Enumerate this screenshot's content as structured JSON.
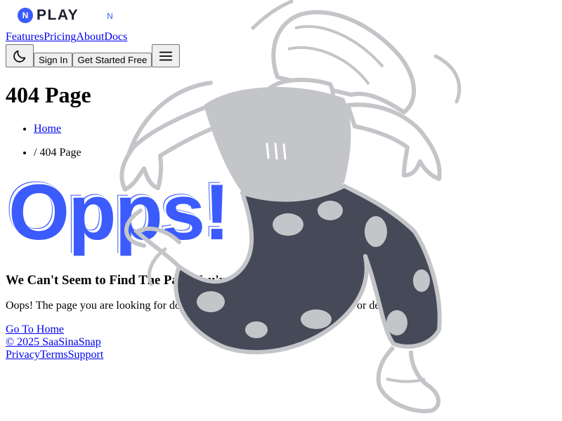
{
  "brand": {
    "name": "PLAY",
    "mark": "N",
    "accent_color": "#3b5bfd"
  },
  "nav": {
    "links": [
      "Features",
      "Pricing",
      "About",
      "Docs"
    ],
    "theme_icon": "moon-icon",
    "sign_in": "Sign In",
    "get_started": "Get Started Free",
    "menu_icon": "hamburger-menu-icon"
  },
  "page": {
    "title": "404 Page",
    "breadcrumbs": {
      "home": "Home",
      "current": "/ 404 Page"
    },
    "big_text": "Opps!",
    "headline": "We Can't Seem to Find The Page You're Looking For",
    "message": "Oops! The page you are looking for does not exist. It might have been moved or deleted.",
    "home_link": "Go To Home"
  },
  "footer": {
    "copyright": "© 2025 SaaSinaSnap",
    "links": [
      "Privacy",
      "Terms",
      "Support"
    ]
  },
  "illustration": {
    "icon": "dancing-character-illustration",
    "body_color": "#c4c5c9",
    "pants_color": "#454958"
  }
}
